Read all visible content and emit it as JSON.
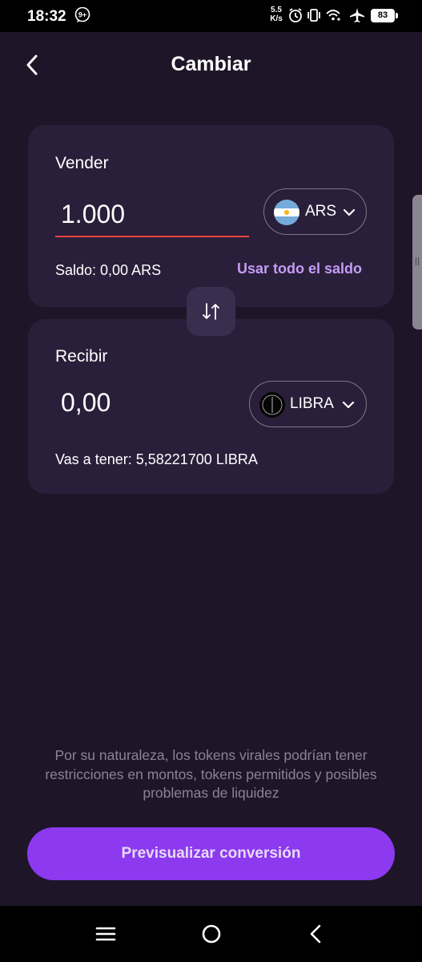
{
  "status_bar": {
    "time": "18:32",
    "notification_badge": "9+",
    "net_speed_value": "5.5",
    "net_speed_unit": "K/s",
    "battery_level": "83"
  },
  "header": {
    "title": "Cambiar"
  },
  "sell": {
    "label": "Vender",
    "amount": "1.000",
    "currency_code": "ARS",
    "currency_icon": "argentina-flag-icon",
    "balance_text": "Saldo: 0,00 ARS",
    "use_all_label": "Usar todo el saldo"
  },
  "receive": {
    "label": "Recibir",
    "amount": "0,00",
    "currency_code": "LIBRA",
    "currency_icon": "libra-token-icon",
    "result_text": "Vas a tener: 5,58221700 LIBRA"
  },
  "disclaimer": "Por su naturaleza, los tokens virales podrían tener restricciones en montos, tokens permitidos y posibles problemas de liquidez",
  "primary_button_label": "Previsualizar conversión",
  "colors": {
    "background": "#1e1628",
    "card": "#2a1f3a",
    "accent": "#8c39f0",
    "link": "#c49cf6",
    "input_underline": "#e8453c"
  }
}
